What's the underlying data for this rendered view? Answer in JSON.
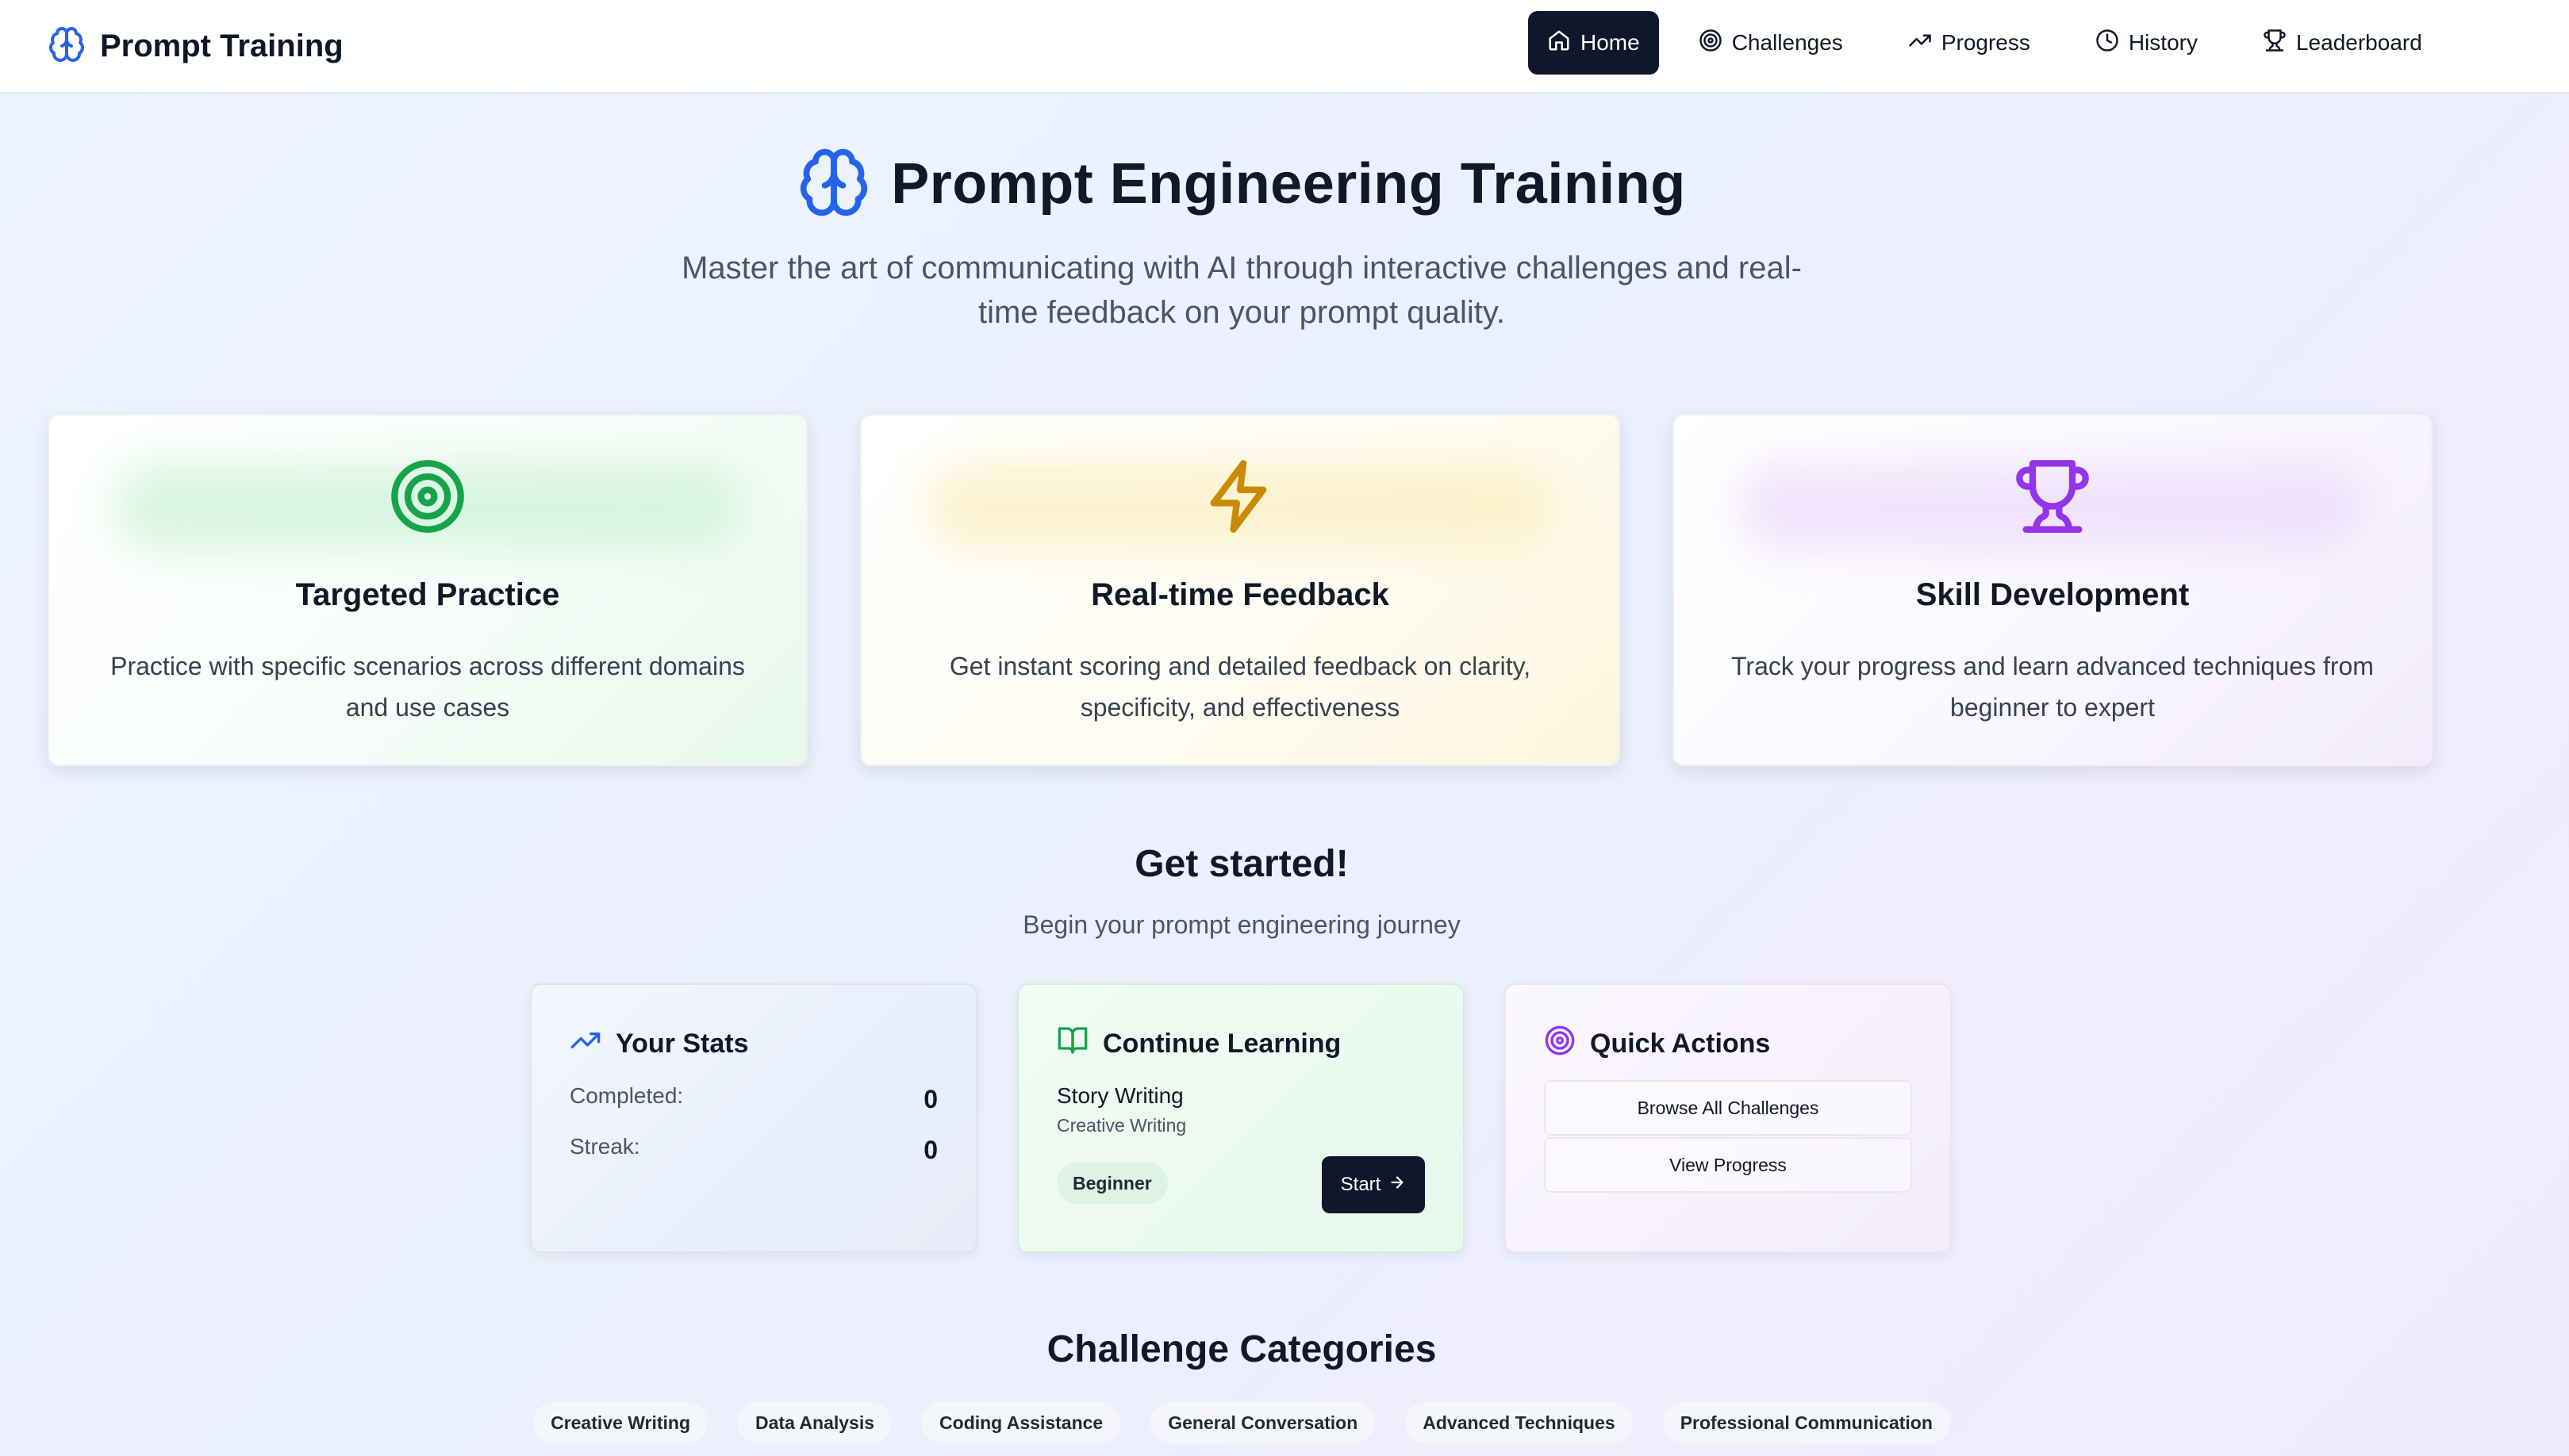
{
  "app": {
    "brand_title": "Prompt Training",
    "brand_icon": "brain-icon",
    "nav": [
      {
        "label": "Home",
        "icon": "home-icon",
        "active": true
      },
      {
        "label": "Challenges",
        "icon": "target-icon",
        "active": false
      },
      {
        "label": "Progress",
        "icon": "trending-up-icon",
        "active": false
      },
      {
        "label": "History",
        "icon": "clock-icon",
        "active": false
      },
      {
        "label": "Leaderboard",
        "icon": "trophy-icon",
        "active": false
      }
    ]
  },
  "hero": {
    "title": "Prompt Engineering Training",
    "subtitle": "Master the art of communicating with AI through interactive challenges and real-time feedback on your prompt quality."
  },
  "features": [
    {
      "title": "Targeted Practice",
      "description": "Practice with specific scenarios across different domains and use cases",
      "icon": "target-icon",
      "color": "#16a34a"
    },
    {
      "title": "Real-time Feedback",
      "description": "Get instant scoring and detailed feedback on clarity, specificity, and effectiveness",
      "icon": "lightning-icon",
      "color": "#ca8a04"
    },
    {
      "title": "Skill Development",
      "description": "Track your progress and learn advanced techniques from beginner to expert",
      "icon": "trophy-icon",
      "color": "#9333ea"
    }
  ],
  "get_started": {
    "title": "Get started!",
    "subtitle": "Begin your prompt engineering journey"
  },
  "stats": {
    "title": "Your Stats",
    "completed_label": "Completed:",
    "completed_value": "0",
    "streak_label": "Streak:",
    "streak_value": "0"
  },
  "continue_learning": {
    "title": "Continue Learning",
    "challenge_title": "Story Writing",
    "challenge_category": "Creative Writing",
    "level": "Beginner",
    "start_label": "Start"
  },
  "quick_actions": {
    "title": "Quick Actions",
    "browse_label": "Browse All Challenges",
    "progress_label": "View Progress"
  },
  "categories": {
    "title": "Challenge Categories",
    "items": [
      "Creative Writing",
      "Data Analysis",
      "Coding Assistance",
      "General Conversation",
      "Advanced Techniques",
      "Professional Communication"
    ]
  },
  "colors": {
    "primary_dark": "#0f172a",
    "brand_blue": "#2563eb",
    "green": "#16a34a",
    "amber": "#ca8a04",
    "purple": "#9333ea"
  }
}
